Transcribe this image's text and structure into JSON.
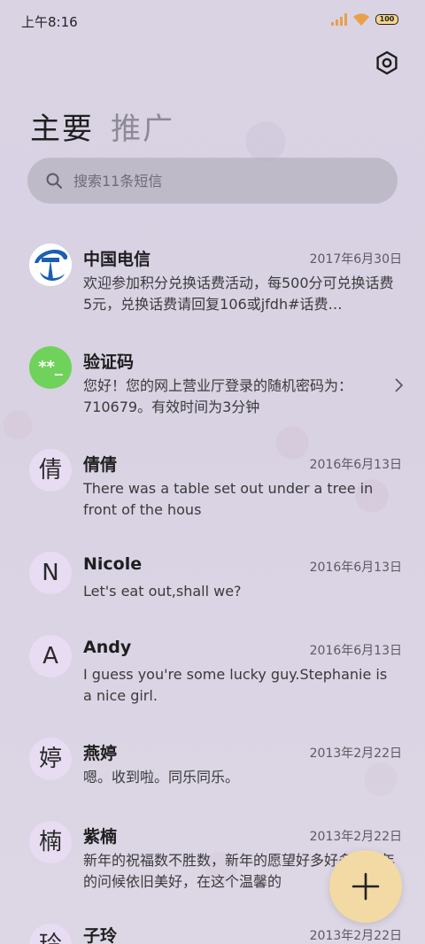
{
  "status_bar": {
    "time": "上午8:16",
    "battery": "100"
  },
  "tabs": [
    {
      "label": "主要"
    },
    {
      "label": "推广"
    }
  ],
  "search": {
    "placeholder": "搜索11条短信"
  },
  "conversations": [
    {
      "name": "中国电信",
      "date": "2017年6月30日",
      "preview": "欢迎参加积分兑换话费活动，每500分可兑换话费5元，兑换话费请回复106或jfdh#话费…",
      "avatar": "telecom-logo"
    },
    {
      "name": "验证码",
      "date": "",
      "preview": "您好！您的网上营业厅登录的随机密码为：710679。有效时间为3分钟",
      "avatar_text": "**_"
    },
    {
      "name": "倩倩",
      "date": "2016年6月13日",
      "preview": "There was a table set out under a tree in front of the hous",
      "avatar_text": "倩"
    },
    {
      "name": "Nicole",
      "date": "2016年6月13日",
      "preview": "Let's eat out,shall we?",
      "avatar_text": "N"
    },
    {
      "name": "Andy",
      "date": "2016年6月13日",
      "preview": "I guess you're some lucky guy.Stephanie is a nice girl.",
      "avatar_text": "A"
    },
    {
      "name": "燕婷",
      "date": "2013年2月22日",
      "preview": "嗯。收到啦。同乐同乐。",
      "avatar_text": "婷"
    },
    {
      "name": "紫楠",
      "date": "2013年2月22日",
      "preview": "新年的祝福数不胜数，新年的愿望好多好多，新年的问候依旧美好，在这个温馨的",
      "avatar_text": "楠"
    },
    {
      "name": "子玲",
      "date": "2013年2月22日",
      "preview": "",
      "avatar_text": "玲"
    }
  ],
  "colors": {
    "accent_fab": "#f3d9a3",
    "verify_avatar": "#6fd25a",
    "avatar_bg": "#e8dcf3"
  },
  "icons": {
    "settings": "gear-icon",
    "search": "search-icon",
    "compose": "plus-icon",
    "chevron": "chevron-right-icon"
  }
}
